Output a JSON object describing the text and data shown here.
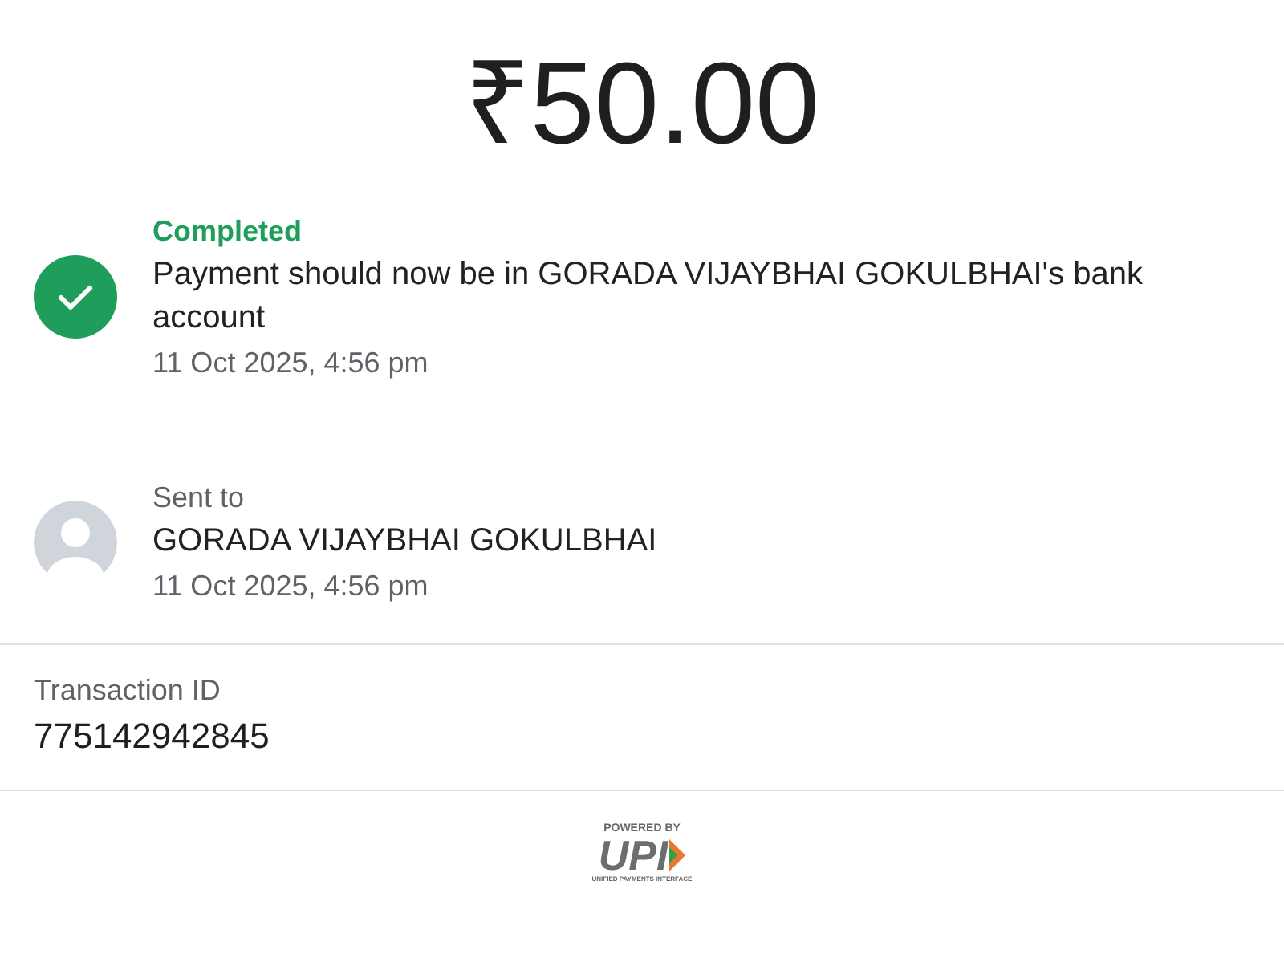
{
  "amount": "₹50.00",
  "status": {
    "kind": "completed",
    "label": "Completed",
    "message": "Payment should now be in GORADA VIJAYBHAI GOKULBHAI's bank account",
    "time": "11 Oct 2025, 4:56 pm"
  },
  "recipient": {
    "label": "Sent to",
    "name": "GORADA VIJAYBHAI GOKULBHAI",
    "time": "11 Oct 2025, 4:56 pm"
  },
  "transaction": {
    "label": "Transaction ID",
    "value": "775142942845"
  },
  "footer_logo": {
    "powered_by": "POWERED BY",
    "mark": "UPI",
    "tagline": "UNIFIED PAYMENTS INTERFACE"
  }
}
